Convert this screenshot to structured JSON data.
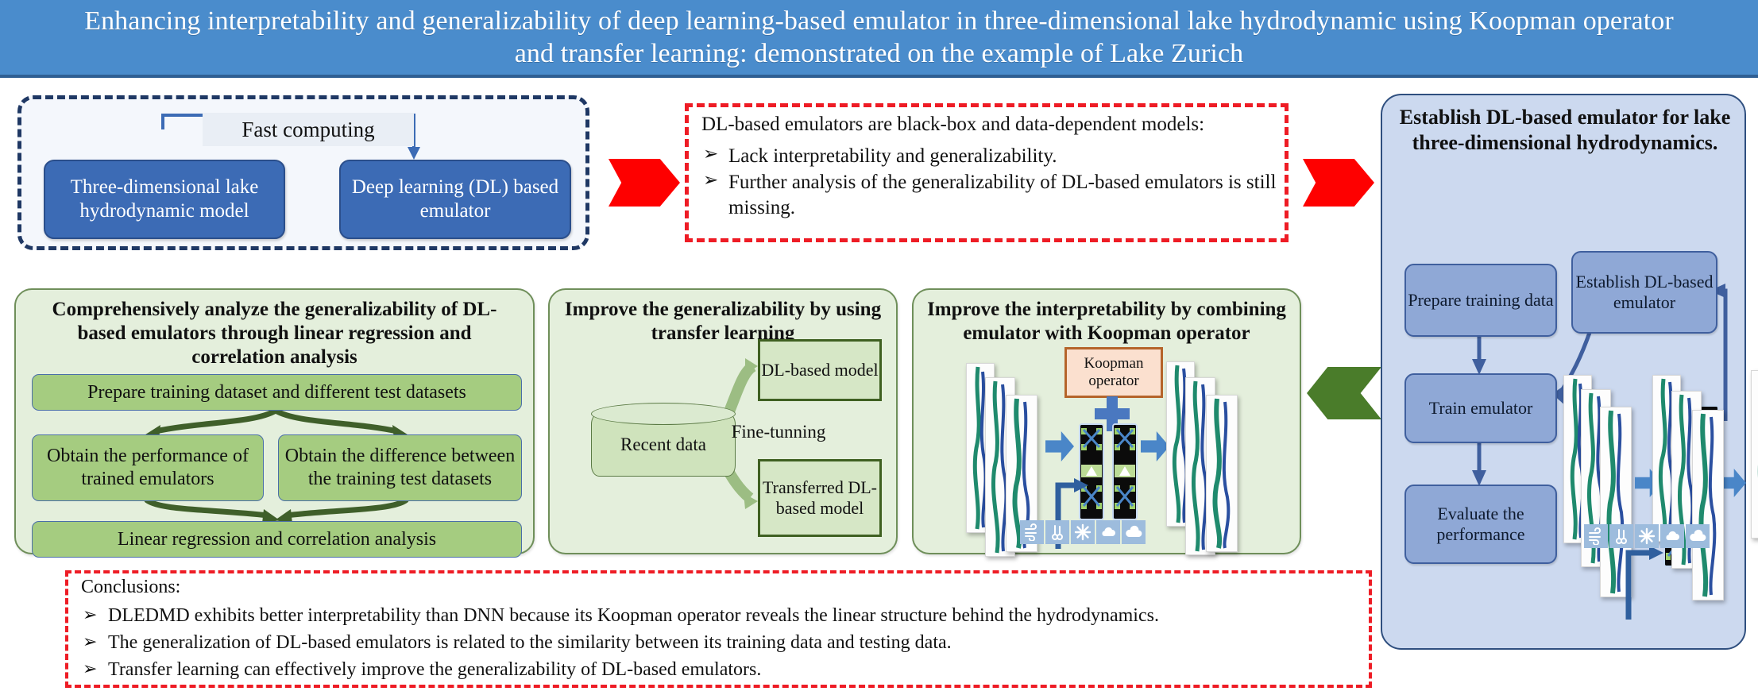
{
  "title": {
    "line1": "Enhancing interpretability and generalizability of deep learning-based emulator in three-dimensional lake hydrodynamic",
    "line2": "using Koopman operator and transfer learning: demonstrated on the example of Lake Zurich",
    "banner_color": "#4a8ccc"
  },
  "fast_computing": {
    "label": "Fast computing",
    "left_box": "Three-dimensional lake hydrodynamic model",
    "right_box": "Deep learning (DL) based emulator",
    "border_color": "#1f3864",
    "box_color": "#3c6bb5"
  },
  "problem": {
    "heading": "DL-based emulators are black-box and data-dependent models:",
    "bullets": [
      "Lack interpretability and generalizability.",
      "Further analysis of the generalizability of DL-based emulators is still missing."
    ],
    "bullet_glyph": "➢",
    "border_color": "#ee1c25"
  },
  "arrows": {
    "red_color": "#fe0000",
    "green_color": "#4a7c2a"
  },
  "establish": {
    "title": "Establish DL-based emulator for lake three-dimensional hydrodynamics.",
    "steps": [
      {
        "id": "prepare",
        "label": "Prepare training data"
      },
      {
        "id": "establish",
        "label": "Establish DL-based emulator"
      },
      {
        "id": "train",
        "label": "Train emulator"
      },
      {
        "id": "evaluate",
        "label": "Evaluate the performance"
      }
    ],
    "panel_color": "#ccd9ef",
    "step_color": "#8fa8d6"
  },
  "panel_generalizability": {
    "title": "Comprehensively analyze the generalizability of DL-based emulators through linear regression and correlation analysis",
    "bars": [
      "Prepare training dataset and different test datasets",
      "Obtain the performance of trained emulators",
      "Obtain the difference between the training test datasets",
      "Linear regression and correlation analysis"
    ],
    "bar_color": "#a5cc80"
  },
  "panel_transfer": {
    "title": "Improve the generalizability by using transfer learning",
    "data_store": "Recent data",
    "fine_tuning": "Fine-tunning",
    "model_top": "DL-based model",
    "model_bottom": "Transferred DL-based model"
  },
  "panel_interpretability": {
    "title": "Improve the interpretability by combining emulator with Koopman operator",
    "koopman": "Koopman operator",
    "plus": "+",
    "weather_icons": [
      "wind-icon",
      "thermometer-icon",
      "sun-icon",
      "cloud-icon",
      "cloud-icon"
    ]
  },
  "conclusions": {
    "heading": "Conclusions:",
    "bullet_glyph": "➢",
    "items": [
      "DLEDMD exhibits better interpretability than DNN because its Koopman operator reveals the linear structure behind the hydrodynamics.",
      "The generalization of DL-based emulators is related to the similarity between its training data and testing data.",
      "Transfer learning can effectively improve the generalizability of DL-based emulators."
    ],
    "border_color": "#ee1c25"
  }
}
